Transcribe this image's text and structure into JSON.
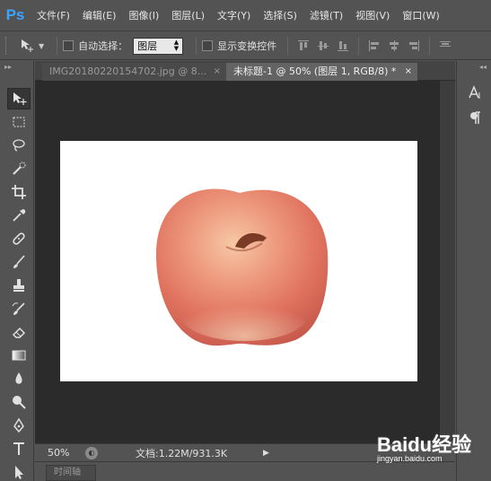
{
  "app": {
    "logo": "Ps"
  },
  "menu": [
    "文件(F)",
    "编辑(E)",
    "图像(I)",
    "图层(L)",
    "文字(Y)",
    "选择(S)",
    "滤镜(T)",
    "视图(V)",
    "窗口(W)"
  ],
  "options": {
    "auto_select_label": "自动选择：",
    "auto_select_value": "图层",
    "show_transform_label": "显示变换控件"
  },
  "tabs": [
    {
      "label": "IMG20180220154702.jpg @ 8...",
      "close": "×"
    },
    {
      "label": "未标题-1 @ 50% (图层 1, RGB/8) *",
      "close": "×"
    }
  ],
  "status": {
    "zoom": "50%",
    "doc_info": "文档:1.22M/931.3K"
  },
  "timeline": {
    "label": "时间轴"
  },
  "watermark": {
    "brand": "Baidu经验",
    "url": "jingyan.baidu.com"
  },
  "colors": {
    "accent": "#3ca3ff",
    "canvas": "#ffffff",
    "workspace": "#2b2b2b",
    "chrome": "#535353"
  }
}
